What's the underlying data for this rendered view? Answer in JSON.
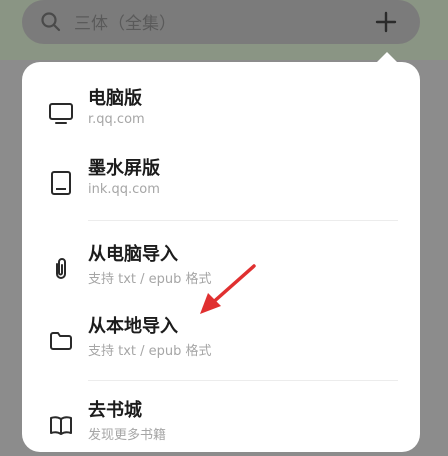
{
  "search": {
    "placeholder": "三体（全集）"
  },
  "menu": {
    "items": [
      {
        "title": "电脑版",
        "subtitle": "r.qq.com",
        "icon": "monitor-icon"
      },
      {
        "title": "墨水屏版",
        "subtitle": "ink.qq.com",
        "icon": "tablet-icon"
      },
      {
        "title": "从电脑导入",
        "subtitle": "支持 txt / epub 格式",
        "icon": "paperclip-icon"
      },
      {
        "title": "从本地导入",
        "subtitle": "支持 txt / epub 格式",
        "icon": "folder-icon"
      },
      {
        "title": "去书城",
        "subtitle": "发现更多书籍",
        "icon": "book-icon"
      }
    ]
  },
  "colors": {
    "annotation_arrow": "#e03030"
  }
}
